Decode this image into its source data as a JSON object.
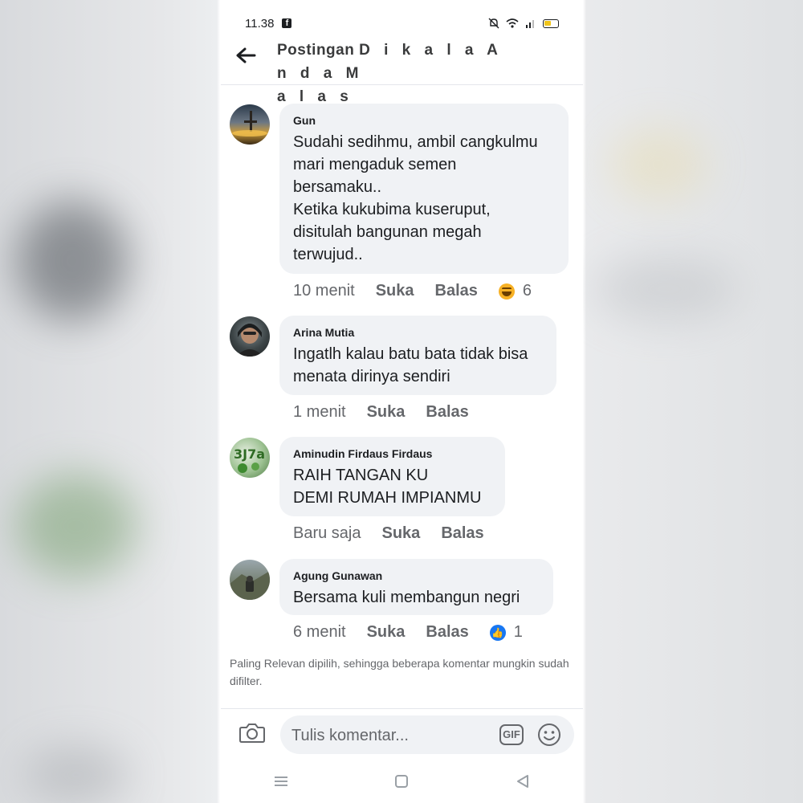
{
  "status_bar": {
    "time": "11.38",
    "app_glyph": "f"
  },
  "header": {
    "title_first": "Postingan ",
    "title_spaced_1": "D i k a l a  A n d a  M",
    "title_spaced_2": "a l a s"
  },
  "comments": [
    {
      "author": "Gun",
      "lines": [
        "Sudahi sedihmu, ambil cangkulmu",
        "mari mengaduk semen",
        "bersamaku..",
        "Ketika kukubima kuseruput,",
        "disitulah bangunan megah",
        "terwujud.."
      ],
      "time": "10 menit",
      "like": "Suka",
      "reply": "Balas",
      "reaction": {
        "type": "haha-emoji-icon",
        "count": "6"
      }
    },
    {
      "author": "Arina Mutia",
      "lines": [
        "Ingatlh kalau batu bata tidak bisa",
        "menata dirinya sendiri"
      ],
      "time": "1 menit",
      "like": "Suka",
      "reply": "Balas"
    },
    {
      "author": "Aminudin Firdaus Firdaus",
      "lines": [
        "RAIH TANGAN KU",
        "DEMI RUMAH IMPIANMU"
      ],
      "time": "Baru saja",
      "like": "Suka",
      "reply": "Balas"
    },
    {
      "author": "Agung Gunawan",
      "lines": [
        "Bersama kuli membangun negri"
      ],
      "time": "6 menit",
      "like": "Suka",
      "reply": "Balas",
      "reaction": {
        "type": "like-emoji-icon",
        "count": "1"
      }
    }
  ],
  "filter_note": "Paling Relevan dipilih, sehingga beberapa komentar mungkin sudah difilter.",
  "composer": {
    "placeholder": "Tulis komentar...",
    "gif_label": "GIF"
  },
  "colors": {
    "bubble": "#f0f2f5",
    "text": "#1c1e21",
    "muted": "#65676b",
    "like_blue": "#1877f2",
    "haha_yellow": "#f7b125"
  }
}
